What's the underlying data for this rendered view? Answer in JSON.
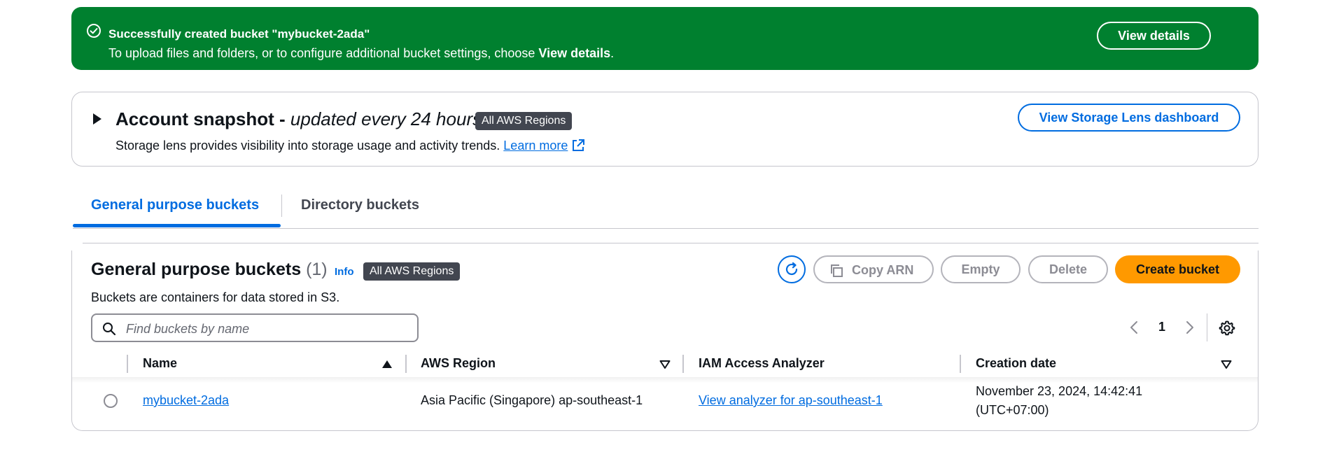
{
  "flash": {
    "title": "Successfully created bucket \"mybucket-2ada\"",
    "message_pre": "To upload files and folders, or to configure additional bucket settings, choose ",
    "message_bold": "View details",
    "message_post": ".",
    "button_label": "View details",
    "color": "#00802f"
  },
  "snapshot": {
    "title_bold": "Account snapshot - ",
    "title_italic": "updated every 24 hours",
    "badge": "All AWS Regions",
    "description": "Storage lens provides visibility into storage usage and activity trends. ",
    "learn_more": "Learn more",
    "lens_button": "View Storage Lens dashboard"
  },
  "tabs": [
    {
      "label": "General purpose buckets",
      "active": true
    },
    {
      "label": "Directory buckets",
      "active": false
    }
  ],
  "panel": {
    "title": "General purpose buckets",
    "count": "(1)",
    "info": "Info",
    "badge": "All AWS Regions",
    "description": "Buckets are containers for data stored in S3.",
    "search_placeholder": "Find buckets by name",
    "buttons": {
      "copy_arn": "Copy ARN",
      "empty": "Empty",
      "delete": "Delete",
      "create": "Create bucket"
    },
    "page": "1",
    "columns": [
      "Name",
      "AWS Region",
      "IAM Access Analyzer",
      "Creation date"
    ],
    "rows": [
      {
        "name": "mybucket-2ada",
        "region": "Asia Pacific (Singapore) ap-southeast-1",
        "analyzer": "View analyzer for ap-southeast-1",
        "created_line1": "November 23, 2024, 14:42:41",
        "created_line2": "(UTC+07:00)"
      }
    ]
  },
  "colors": {
    "accent": "#006ce0",
    "primary_button": "#ff9900",
    "badge": "#424650"
  },
  "icons": [
    "check-circle-icon",
    "close-icon",
    "caret-right-icon",
    "external-link-icon",
    "refresh-icon",
    "copy-icon",
    "search-icon",
    "chevron-left-icon",
    "chevron-right-icon",
    "settings-gear-icon",
    "sort-ascending-icon",
    "sort-descending-icon"
  ]
}
